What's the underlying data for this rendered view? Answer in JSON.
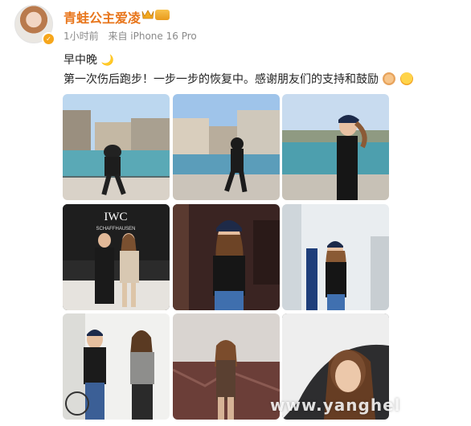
{
  "post": {
    "username": "青蛙公主爱凌",
    "time": "1小时前",
    "source": "来自 iPhone 16 Pro",
    "line1": "早中晚",
    "line2": "第一次伤后跑步！一步一步的恢复中。感谢朋友们的支持和鼓励",
    "level_badge": "",
    "icons": [
      "verified-badge-icon",
      "crown-icon",
      "moon-icon",
      "folded-hands-emoji-icon",
      "kiss-face-emoji-icon"
    ]
  },
  "photos": [
    {
      "label": "running-along-river-1"
    },
    {
      "label": "running-along-river-2"
    },
    {
      "label": "stretching-by-river"
    },
    {
      "label": "iwc-event-photo",
      "sign_text": "IWC",
      "sign_sub": "SCHAFFHAUSEN"
    },
    {
      "label": "portrait-red-cap"
    },
    {
      "label": "speaking-on-stage"
    },
    {
      "label": "conversation-photo"
    },
    {
      "label": "marble-wall-portrait"
    },
    {
      "label": "close-up-portrait"
    }
  ],
  "watermark": "www.yanghel",
  "colors": {
    "username": "#e8761c",
    "meta": "#8a8a8a",
    "text": "#222222"
  }
}
